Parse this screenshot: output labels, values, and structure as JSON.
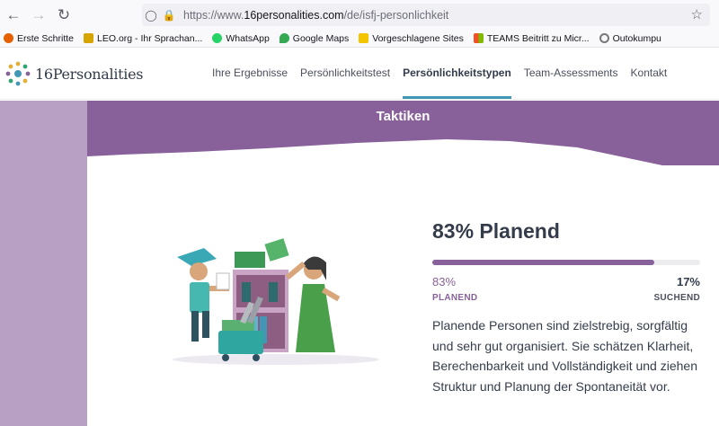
{
  "browser": {
    "url_prefix": "https://www.",
    "url_domain": "16personalities.com",
    "url_path": "/de/isfj-personlichkeit",
    "bookmarks": [
      {
        "label": "Erste Schritte",
        "color": "#e66000"
      },
      {
        "label": "LEO.org - Ihr Sprachan...",
        "color": "#d8a400"
      },
      {
        "label": "WhatsApp",
        "color": "#25d366"
      },
      {
        "label": "Google Maps",
        "color": "#34a853"
      },
      {
        "label": "Vorgeschlagene Sites",
        "color": "#f5c400"
      },
      {
        "label": "TEAMS Beitritt zu Micr...",
        "color": "#5059c9"
      },
      {
        "label": "Outokumpu",
        "color": "#777777"
      }
    ]
  },
  "site": {
    "logo_number": "16",
    "logo_word": "Personalities",
    "nav": [
      {
        "label": "Ihre Ergebnisse"
      },
      {
        "label": "Persönlichkeitstest"
      },
      {
        "label": "Persönlichkeitstypen",
        "active": true
      },
      {
        "label": "Team-Assessments"
      },
      {
        "label": "Kontakt"
      }
    ]
  },
  "section": {
    "title": "Taktiken",
    "heading": "83% Planend",
    "left_percent": "83%",
    "right_percent": "17%",
    "left_label": "PLANEND",
    "right_label": "SUCHEND",
    "fill_fraction": 0.83,
    "description": "Planende Personen sind zielstrebig, sorgfältig und sehr gut organisiert. Sie schätzen Klarheit, Berechenbarkeit und Vollständigkeit und ziehen Struktur und Planung der Spontaneität vor."
  },
  "colors": {
    "accent_purple": "#88619a",
    "side_band": "#b89fc4",
    "nav_underline": "#4298b4"
  }
}
